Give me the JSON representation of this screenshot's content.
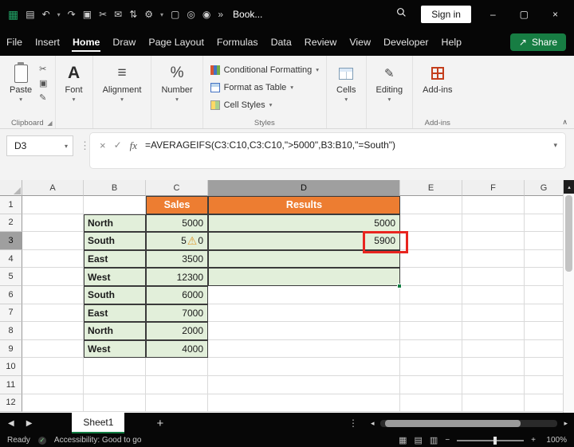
{
  "colors": {
    "accent_green": "#107C41",
    "table_header_orange": "#ED7D31",
    "table_fill_green": "#E2EFDA",
    "annotation_red": "#E8251F",
    "warning_orange": "#DF9C33"
  },
  "titlebar": {
    "icons": [
      {
        "name": "excel-logo",
        "glyph": "▦"
      },
      {
        "name": "save",
        "glyph": "▤"
      },
      {
        "name": "undo",
        "glyph": "↶"
      },
      {
        "name": "undo-chevron",
        "glyph": "▾"
      },
      {
        "name": "redo",
        "glyph": "↷"
      },
      {
        "name": "clipboard",
        "glyph": "▣"
      },
      {
        "name": "cut",
        "glyph": "✂"
      },
      {
        "name": "mail",
        "glyph": "✉"
      },
      {
        "name": "sort",
        "glyph": "⇅"
      },
      {
        "name": "settings",
        "glyph": "⚙"
      },
      {
        "name": "settings-chevron",
        "glyph": "▾"
      },
      {
        "name": "new-document",
        "glyph": "▢"
      },
      {
        "name": "pin",
        "glyph": "◎"
      },
      {
        "name": "camera",
        "glyph": "◉"
      },
      {
        "name": "overflow",
        "glyph": "»"
      }
    ],
    "title": "Book...",
    "sign_in_label": "Sign in",
    "minimize_glyph": "–",
    "maximize_glyph": "▢",
    "close_glyph": "×"
  },
  "menubar": {
    "tabs": [
      "File",
      "Insert",
      "Home",
      "Draw",
      "Page Layout",
      "Formulas",
      "Data",
      "Review",
      "View",
      "Developer",
      "Help"
    ],
    "active_tab": "Home",
    "share_icon_glyph": "↗",
    "share_label": "Share"
  },
  "ribbon": {
    "paste_label": "Paste",
    "cut_glyph": "✂",
    "copy_glyph": "▣",
    "format_painter_glyph": "✎",
    "font_label": "Font",
    "font_icon_glyph": "A",
    "alignment_label": "Alignment",
    "alignment_icon_glyph": "≡",
    "number_label": "Number",
    "number_icon_glyph": "%",
    "conditional_formatting_label": "Conditional Formatting",
    "format_as_table_label": "Format as Table",
    "cell_styles_label": "Cell Styles",
    "cells_label": "Cells",
    "editing_label": "Editing",
    "editing_icon_glyph": "✎",
    "addins_label": "Add-ins",
    "clipboard_group_label": "Clipboard",
    "styles_group_label": "Styles",
    "addins_group_label": "Add-ins",
    "dropdown_glyph": "▾",
    "collapse_glyph": "∧"
  },
  "formula_bar": {
    "name_box_value": "D3",
    "name_box_chevron": "▾",
    "menu_dots_glyph": "⋮",
    "cancel_glyph": "×",
    "enter_glyph": "✓",
    "fx_label": "fx",
    "formula": "=AVERAGEIFS(C3:C10,C3:C10,\">5000\",B3:B10,\"=South\")",
    "expand_glyph": "▾"
  },
  "grid": {
    "col_headers": [
      "A",
      "B",
      "C",
      "D",
      "E",
      "F",
      "G"
    ],
    "selected_col": "D",
    "row_headers": [
      "1",
      "2",
      "3",
      "4",
      "5",
      "6",
      "7",
      "8",
      "9",
      "10",
      "11",
      "12"
    ],
    "selected_row": "3",
    "scroll_up_glyph": "▴",
    "table": {
      "sales_header": "Sales",
      "results_header": "Results",
      "warning_glyph": "⚠",
      "rows": [
        {
          "region": "North",
          "sales": "5000",
          "result": "5000"
        },
        {
          "region": "South",
          "sales_prefix": "5",
          "sales_suffix": "0",
          "result": "5900"
        },
        {
          "region": "East",
          "sales": "3500"
        },
        {
          "region": "West",
          "sales": "12300"
        },
        {
          "region": "South",
          "sales": "6000"
        },
        {
          "region": "East",
          "sales": "7000"
        },
        {
          "region": "North",
          "sales": "2000"
        },
        {
          "region": "West",
          "sales": "4000"
        }
      ]
    }
  },
  "sheet_bar": {
    "prev_glyph": "◀",
    "next_glyph": "▶",
    "sheet_tab_label": "Sheet1",
    "add_sheet_glyph": "+",
    "menu_glyph": "⋮",
    "scroll_left_glyph": "◂",
    "scroll_right_glyph": "▸"
  },
  "status_bar": {
    "mode": "Ready",
    "accessibility_check_glyph": "✓",
    "accessibility": "Accessibility: Good to go",
    "view_normal_glyph": "▦",
    "view_layout_glyph": "▤",
    "view_break_glyph": "▥",
    "zoom_out_glyph": "−",
    "zoom_in_glyph": "+",
    "zoom_level": "100%"
  }
}
